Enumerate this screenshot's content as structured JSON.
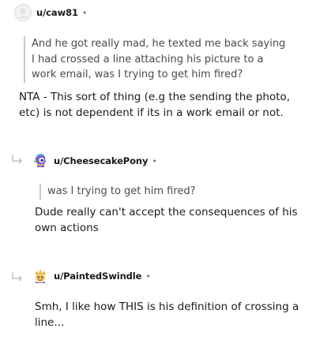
{
  "comments": [
    {
      "username": "u/caw81",
      "separator": "•",
      "avatar": "grey-placeholder-avatar",
      "quote": "And he got really mad, he texted me back saying\nI had crossed a line attaching his picture to a\nwork email, was I trying to get him fired?",
      "body": "NTA - This sort of thing (e.g the sending the photo, etc) is not dependent if its in a work email or not."
    },
    {
      "username": "u/CheesecakePony",
      "separator": "•",
      "avatar": "cheesecake-pony-avatar",
      "quote": "was I trying to get him fired?",
      "body": "Dude really can't accept the consequences of his own actions"
    },
    {
      "username": "u/PaintedSwindle",
      "separator": "•",
      "avatar": "painted-swindle-avatar",
      "body": "Smh, I like how THIS is his definition of crossing a line..."
    }
  ],
  "colors": {
    "username": "#1a1a1b",
    "quote_bar": "#c8c8c8",
    "quote_text": "#4a4a4a",
    "meta": "#7c7c7c"
  }
}
